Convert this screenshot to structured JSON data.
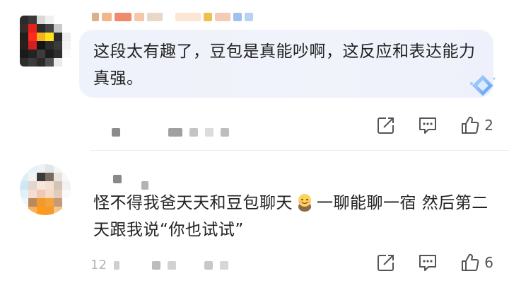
{
  "comments": [
    {
      "avatar": "pixelated-avatar",
      "text": "这段太有趣了，豆包是真能吵啊，这反应和表达能力真强。",
      "actions": {
        "share_icon": "share-icon",
        "reply_icon": "reply-icon",
        "like_icon": "thumb-up-icon",
        "like_count": "2"
      }
    },
    {
      "avatar": "pixelated-avatar",
      "text_before": "怪不得我爸天天和豆包聊天",
      "emoji": "hugging-emoji",
      "text_after": "一聊能聊一宿 然后第二天跟我说“你也试试”",
      "meta_prefix": "12",
      "actions": {
        "share_icon": "share-icon",
        "reply_icon": "reply-icon",
        "like_icon": "thumb-up-icon",
        "like_count": "6"
      }
    }
  ],
  "colors": {
    "bubble": "#eff2fb",
    "text": "#222222",
    "icon": "#555555",
    "divider": "#ececec"
  }
}
